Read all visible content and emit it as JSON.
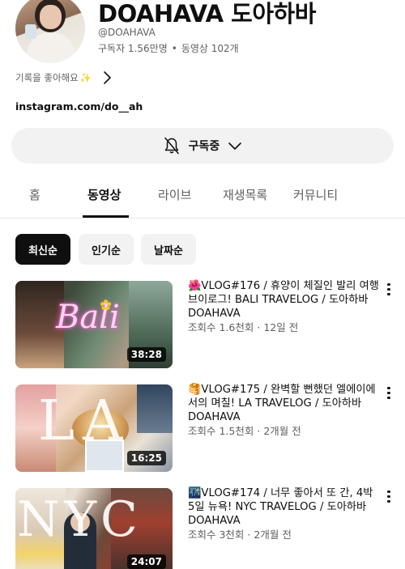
{
  "channel": {
    "name": "DOAHAVA 도아하바",
    "handle": "@DOAHAVA",
    "subscribers": "구독자 1.56만명",
    "videos_count": "동영상 102개",
    "stats_separator": "•",
    "description": "기록을 좋아해요",
    "description_emoji": "✨",
    "link": "instagram.com/do__ah"
  },
  "subscribe": {
    "label": "구독중"
  },
  "tabs": [
    {
      "label": "홈",
      "active": false
    },
    {
      "label": "동영상",
      "active": true
    },
    {
      "label": "라이브",
      "active": false
    },
    {
      "label": "재생목록",
      "active": false
    },
    {
      "label": "커뮤니티",
      "active": false
    }
  ],
  "chips": [
    {
      "label": "최신순",
      "selected": true
    },
    {
      "label": "인기순",
      "selected": false
    },
    {
      "label": "날짜순",
      "selected": false
    }
  ],
  "videos": [
    {
      "emoji": "🌺",
      "title": "VLOG#176 / 휴양이 체질인 발리 여행 브이로그! BALI TRAVELOG / 도아하바 DOAHAVA",
      "views": "조회수 1.6천회",
      "age": "12일 전",
      "duration": "38:28",
      "thumb_text": "Bali"
    },
    {
      "emoji": "🥞",
      "title": "VLOG#175 / 완벽할 뻔했던 엘에이에서의 며칠! LA TRAVELOG / 도아하바 DOAHAVA",
      "views": "조회수 1.5천회",
      "age": "2개월 전",
      "duration": "16:25",
      "thumb_text": "LA"
    },
    {
      "emoji": "🌃",
      "title": "VLOG#174 / 너무 좋아서 또 간, 4박 5일 뉴욕! NYC TRAVELOG / 도아하바 DOAHAVA",
      "views": "조회수 3천회",
      "age": "2개월 전",
      "duration": "24:07",
      "thumb_text": "NYC"
    }
  ],
  "meta_separator": "·"
}
